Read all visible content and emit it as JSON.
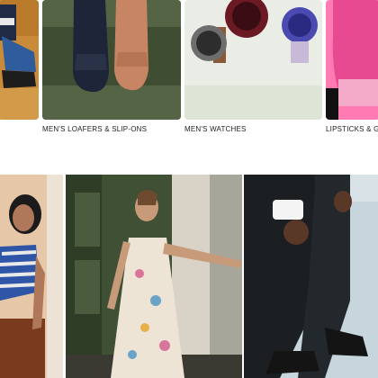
{
  "categories": [
    {
      "label": "",
      "icon": "shoes-on-legs-image"
    },
    {
      "label": "MEN'S LOAFERS & SLIP-ONS",
      "icon": "loafers-image"
    },
    {
      "label": "MEN'S WATCHES",
      "icon": "watches-image"
    },
    {
      "label": "LIPSTICKS & GLO",
      "icon": "lipstick-image"
    }
  ],
  "feature_photos": [
    {
      "icon": "woman-striped-top-image"
    },
    {
      "icon": "woman-floral-dress-image"
    },
    {
      "icon": "man-suit-shoes-image"
    }
  ],
  "colors": {
    "tile1_bg": "#c98a3a",
    "tile2_bg": "#4b5a3a",
    "tile3_bg": "#e9ede6",
    "tile4_bg": "#e85a9a",
    "label_text": "#222222"
  }
}
